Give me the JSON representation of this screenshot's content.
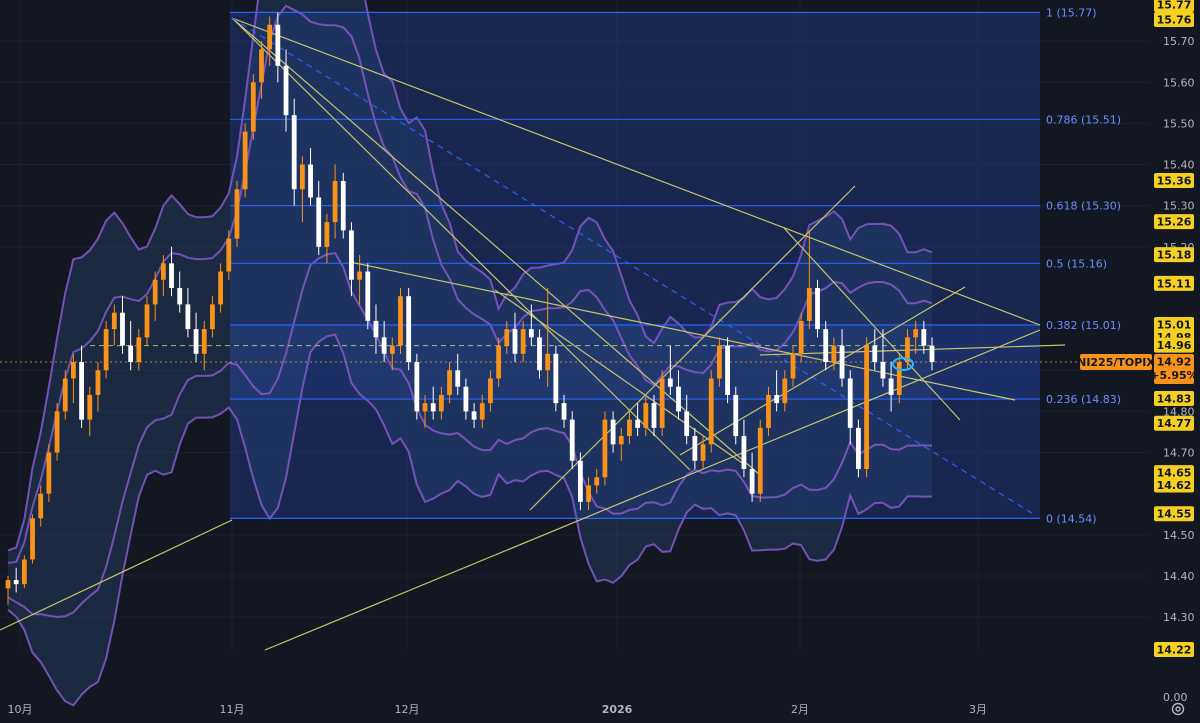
{
  "chart_data": {
    "type": "candlestick",
    "symbol": "NI225/TOPIX",
    "last_price": "14.92",
    "change": "+5.95%",
    "x_tick_labels": [
      "10月",
      "11月",
      "12月",
      "2026",
      "2月",
      "3月"
    ],
    "y_tick_labels": [
      "15.70",
      "15.60",
      "15.50",
      "15.40",
      "15.30",
      "15.20",
      "14.90",
      "14.80",
      "14.70",
      "14.50",
      "14.40",
      "14.30",
      "0.00"
    ],
    "right_tags": [
      {
        "label": "15.77",
        "color": "#f5d020"
      },
      {
        "label": "15.76",
        "color": "#f5d020"
      },
      {
        "label": "15.36",
        "color": "#f5d020"
      },
      {
        "label": "15.26",
        "color": "#f5d020"
      },
      {
        "label": "15.18",
        "color": "#f5d020"
      },
      {
        "label": "15.11",
        "color": "#f5d020"
      },
      {
        "label": "15.01",
        "color": "#f5d020"
      },
      {
        "label": "14.98",
        "color": "#f5d020"
      },
      {
        "label": "14.96",
        "color": "#f5d020"
      },
      {
        "label": "14.83",
        "color": "#f5d020"
      },
      {
        "label": "14.77",
        "color": "#f5d020"
      },
      {
        "label": "14.65",
        "color": "#f5d020"
      },
      {
        "label": "14.62",
        "color": "#f5d020"
      },
      {
        "label": "14.55",
        "color": "#f5d020"
      },
      {
        "label": "14.22",
        "color": "#f5d020"
      }
    ],
    "fib_levels": [
      {
        "label": "1 (15.77)",
        "value": 15.77
      },
      {
        "label": "0.786 (15.51)",
        "value": 15.51
      },
      {
        "label": "0.618 (15.30)",
        "value": 15.3
      },
      {
        "label": "0.5 (15.16)",
        "value": 15.16
      },
      {
        "label": "0.382 (15.01)",
        "value": 15.01
      },
      {
        "label": "0.236 (14.83)",
        "value": 14.83
      },
      {
        "label": "0 (14.54)",
        "value": 14.54
      }
    ],
    "ylim": [
      14.22,
      15.8
    ],
    "colors": {
      "background": "#131722",
      "up": "#f7931a",
      "down": "#ffffff",
      "fib": "#2962ff",
      "band": "#7e57c2",
      "trend": "#c8c36b",
      "tag": "#f5d020",
      "last_tag": "#f7931a"
    },
    "series": [
      {
        "name": "NI225/TOPIX",
        "ohlc": [
          [
            14.37,
            14.4,
            14.33,
            14.39
          ],
          [
            14.39,
            14.42,
            14.36,
            14.38
          ],
          [
            14.38,
            14.45,
            14.37,
            14.44
          ],
          [
            14.44,
            14.55,
            14.43,
            14.54
          ],
          [
            14.54,
            14.62,
            14.52,
            14.6
          ],
          [
            14.6,
            14.72,
            14.58,
            14.7
          ],
          [
            14.7,
            14.82,
            14.68,
            14.8
          ],
          [
            14.8,
            14.9,
            14.78,
            14.88
          ],
          [
            14.88,
            14.94,
            14.82,
            14.92
          ],
          [
            14.92,
            14.96,
            14.76,
            14.78
          ],
          [
            14.78,
            14.86,
            14.74,
            14.84
          ],
          [
            14.84,
            14.92,
            14.8,
            14.9
          ],
          [
            14.9,
            15.02,
            14.88,
            15.0
          ],
          [
            15.0,
            15.06,
            14.96,
            15.04
          ],
          [
            15.04,
            15.08,
            14.94,
            14.96
          ],
          [
            14.96,
            15.02,
            14.9,
            14.92
          ],
          [
            14.92,
            15.0,
            14.9,
            14.98
          ],
          [
            14.98,
            15.08,
            14.96,
            15.06
          ],
          [
            15.06,
            15.14,
            15.02,
            15.12
          ],
          [
            15.12,
            15.18,
            15.08,
            15.16
          ],
          [
            15.16,
            15.2,
            15.08,
            15.1
          ],
          [
            15.1,
            15.14,
            15.04,
            15.06
          ],
          [
            15.06,
            15.1,
            14.98,
            15.0
          ],
          [
            15.0,
            15.04,
            14.92,
            14.94
          ],
          [
            14.94,
            15.02,
            14.9,
            15.0
          ],
          [
            15.0,
            15.08,
            14.98,
            15.06
          ],
          [
            15.06,
            15.16,
            15.04,
            15.14
          ],
          [
            15.14,
            15.24,
            15.12,
            15.22
          ],
          [
            15.22,
            15.36,
            15.2,
            15.34
          ],
          [
            15.34,
            15.5,
            15.32,
            15.48
          ],
          [
            15.48,
            15.62,
            15.46,
            15.6
          ],
          [
            15.6,
            15.7,
            15.56,
            15.68
          ],
          [
            15.68,
            15.76,
            15.64,
            15.74
          ],
          [
            15.74,
            15.77,
            15.6,
            15.64
          ],
          [
            15.64,
            15.68,
            15.48,
            15.52
          ],
          [
            15.52,
            15.56,
            15.3,
            15.34
          ],
          [
            15.34,
            15.42,
            15.26,
            15.4
          ],
          [
            15.4,
            15.44,
            15.3,
            15.32
          ],
          [
            15.32,
            15.36,
            15.18,
            15.2
          ],
          [
            15.2,
            15.28,
            15.16,
            15.26
          ],
          [
            15.26,
            15.4,
            15.22,
            15.36
          ],
          [
            15.36,
            15.38,
            15.22,
            15.24
          ],
          [
            15.24,
            15.26,
            15.08,
            15.12
          ],
          [
            15.12,
            15.18,
            15.06,
            15.14
          ],
          [
            15.14,
            15.16,
            15.0,
            15.02
          ],
          [
            15.02,
            15.06,
            14.94,
            14.98
          ],
          [
            14.98,
            15.02,
            14.92,
            14.94
          ],
          [
            14.94,
            14.98,
            14.9,
            14.96
          ],
          [
            14.96,
            15.1,
            14.94,
            15.08
          ],
          [
            15.08,
            15.1,
            14.9,
            14.92
          ],
          [
            14.92,
            14.94,
            14.78,
            14.8
          ],
          [
            14.8,
            14.84,
            14.76,
            14.82
          ],
          [
            14.82,
            14.86,
            14.78,
            14.8
          ],
          [
            14.8,
            14.86,
            14.78,
            14.84
          ],
          [
            14.84,
            14.92,
            14.82,
            14.9
          ],
          [
            14.9,
            14.94,
            14.84,
            14.86
          ],
          [
            14.86,
            14.88,
            14.78,
            14.8
          ],
          [
            14.8,
            14.82,
            14.76,
            14.78
          ],
          [
            14.78,
            14.84,
            14.76,
            14.82
          ],
          [
            14.82,
            14.9,
            14.8,
            14.88
          ],
          [
            14.88,
            14.98,
            14.86,
            14.96
          ],
          [
            14.96,
            15.02,
            14.94,
            15.0
          ],
          [
            15.0,
            15.04,
            14.92,
            14.94
          ],
          [
            14.94,
            15.02,
            14.92,
            15.0
          ],
          [
            15.0,
            15.06,
            14.96,
            14.98
          ],
          [
            14.98,
            15.0,
            14.88,
            14.9
          ],
          [
            14.9,
            15.1,
            14.86,
            14.94
          ],
          [
            14.94,
            14.96,
            14.8,
            14.82
          ],
          [
            14.82,
            14.84,
            14.76,
            14.78
          ],
          [
            14.78,
            14.8,
            14.66,
            14.68
          ],
          [
            14.68,
            14.7,
            14.56,
            14.58
          ],
          [
            14.58,
            14.64,
            14.56,
            14.62
          ],
          [
            14.62,
            14.66,
            14.6,
            14.64
          ],
          [
            14.64,
            14.8,
            14.62,
            14.78
          ],
          [
            14.78,
            14.8,
            14.7,
            14.72
          ],
          [
            14.72,
            14.76,
            14.68,
            14.74
          ],
          [
            14.74,
            14.8,
            14.72,
            14.78
          ],
          [
            14.78,
            14.82,
            14.74,
            14.76
          ],
          [
            14.76,
            14.84,
            14.74,
            14.82
          ],
          [
            14.82,
            14.84,
            14.74,
            14.76
          ],
          [
            14.76,
            14.9,
            14.74,
            14.88
          ],
          [
            14.88,
            14.96,
            14.84,
            14.86
          ],
          [
            14.86,
            14.9,
            14.78,
            14.8
          ],
          [
            14.8,
            14.84,
            14.72,
            14.74
          ],
          [
            14.74,
            14.76,
            14.66,
            14.68
          ],
          [
            14.68,
            14.74,
            14.66,
            14.72
          ],
          [
            14.72,
            14.9,
            14.7,
            14.88
          ],
          [
            14.88,
            14.98,
            14.86,
            14.96
          ],
          [
            14.96,
            14.98,
            14.82,
            14.84
          ],
          [
            14.84,
            14.86,
            14.72,
            14.74
          ],
          [
            14.74,
            14.78,
            14.64,
            14.66
          ],
          [
            14.66,
            14.7,
            14.58,
            14.6
          ],
          [
            14.6,
            14.78,
            14.58,
            14.76
          ],
          [
            14.76,
            14.86,
            14.74,
            14.84
          ],
          [
            14.84,
            14.9,
            14.8,
            14.82
          ],
          [
            14.82,
            14.9,
            14.8,
            14.88
          ],
          [
            14.88,
            14.96,
            14.86,
            14.94
          ],
          [
            14.94,
            15.04,
            14.92,
            15.02
          ],
          [
            15.02,
            15.24,
            15.0,
            15.1
          ],
          [
            15.1,
            15.12,
            14.98,
            15.0
          ],
          [
            15.0,
            15.02,
            14.9,
            14.92
          ],
          [
            14.92,
            14.98,
            14.9,
            14.96
          ],
          [
            14.96,
            15.0,
            14.86,
            14.88
          ],
          [
            14.88,
            14.9,
            14.72,
            14.76
          ],
          [
            14.76,
            14.78,
            14.64,
            14.66
          ],
          [
            14.66,
            14.98,
            14.64,
            14.96
          ],
          [
            14.96,
            15.0,
            14.9,
            14.92
          ],
          [
            14.92,
            15.0,
            14.86,
            14.88
          ],
          [
            14.88,
            14.92,
            14.8,
            14.84
          ],
          [
            14.84,
            14.94,
            14.82,
            14.92
          ],
          [
            14.92,
            15.0,
            14.9,
            14.98
          ],
          [
            14.98,
            15.02,
            14.94,
            15.0
          ],
          [
            15.0,
            15.02,
            14.94,
            14.96
          ],
          [
            14.96,
            14.98,
            14.9,
            14.92
          ]
        ]
      }
    ]
  }
}
